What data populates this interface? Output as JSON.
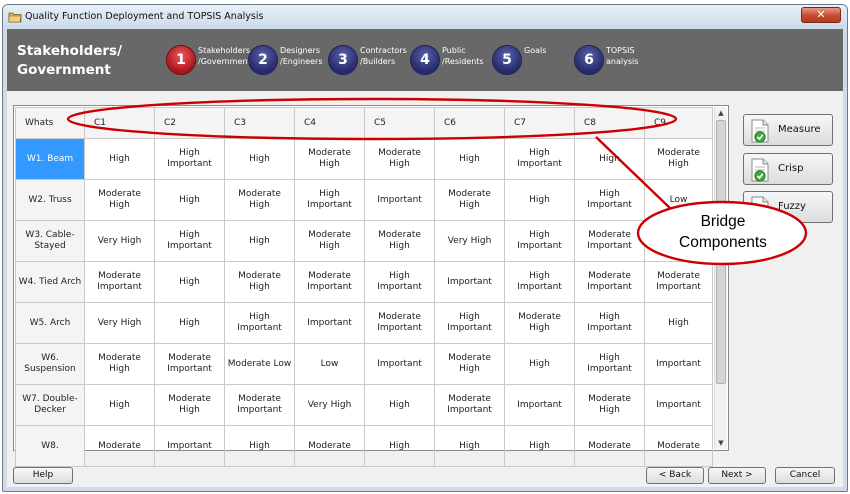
{
  "window": {
    "title": "Quality Function Deployment and TOPSIS Analysis",
    "close_glyph": "✕",
    "app_icon": "folder-icon"
  },
  "header": {
    "title": "Stakeholders/ Government",
    "steps": [
      {
        "number": "1",
        "label_line1": "Stakeholders",
        "label_line2": "/Government",
        "state": "active"
      },
      {
        "number": "2",
        "label_line1": "Designers",
        "label_line2": "/Engineers",
        "state": "inactive"
      },
      {
        "number": "3",
        "label_line1": "Contractors",
        "label_line2": "/Builders",
        "state": "inactive"
      },
      {
        "number": "4",
        "label_line1": "Public",
        "label_line2": "/Residents",
        "state": "inactive"
      },
      {
        "number": "5",
        "label_line1": "Goals",
        "label_line2": "",
        "state": "inactive"
      },
      {
        "number": "6",
        "label_line1": "TOPSIS",
        "label_line2": "analysis",
        "state": "inactive"
      }
    ],
    "colors": {
      "active": "#c4161c",
      "inactive": "#262c6e",
      "header_bg": "#686868"
    }
  },
  "grid": {
    "corner": "Whats",
    "columns": [
      "C1",
      "C2",
      "C3",
      "C4",
      "C5",
      "C6",
      "C7",
      "C8",
      "C9"
    ],
    "rows": [
      {
        "head": "W1. Beam",
        "selected": true,
        "cells": [
          "High",
          "High Important",
          "High",
          "Moderate High",
          "Moderate High",
          "High",
          "High Important",
          "High",
          "Moderate High"
        ]
      },
      {
        "head": "W2. Truss",
        "selected": false,
        "cells": [
          "Moderate High",
          "High",
          "Moderate High",
          "High Important",
          "Important",
          "Moderate High",
          "High",
          "High Important",
          "Low"
        ]
      },
      {
        "head": "W3. Cable-Stayed",
        "selected": false,
        "cells": [
          "Very High",
          "High Important",
          "High",
          "Moderate High",
          "Moderate High",
          "Very High",
          "High Important",
          "Moderate Important",
          ""
        ]
      },
      {
        "head": "W4. Tied Arch",
        "selected": false,
        "cells": [
          "Moderate Important",
          "High",
          "Moderate High",
          "Moderate Important",
          "High Important",
          "Important",
          "High Important",
          "Moderate Important",
          "Moderate Important"
        ]
      },
      {
        "head": "W5. Arch",
        "selected": false,
        "cells": [
          "Very High",
          "High",
          "High Important",
          "Important",
          "Moderate Important",
          "High Important",
          "Moderate High",
          "High Important",
          "High"
        ]
      },
      {
        "head": "W6. Suspension",
        "selected": false,
        "cells": [
          "Moderate High",
          "Moderate Important",
          "Moderate Low",
          "Low",
          "Important",
          "Moderate High",
          "High",
          "High Important",
          "Important"
        ]
      },
      {
        "head": "W7. Double-Decker",
        "selected": false,
        "cells": [
          "High",
          "Moderate High",
          "Moderate Important",
          "Very High",
          "High",
          "Moderate Important",
          "Important",
          "Moderate High",
          "Important"
        ]
      },
      {
        "head": "W8.",
        "selected": false,
        "cells": [
          "Moderate",
          "Important",
          "High",
          "Moderate",
          "High",
          "High",
          "High",
          "Moderate",
          "Moderate"
        ]
      }
    ],
    "selected_color": "#3399ff"
  },
  "side_buttons": [
    {
      "label": "Measure",
      "icon": "document-check-icon"
    },
    {
      "label": "Crisp",
      "icon": "document-check-icon"
    },
    {
      "label": "Fuzzy",
      "icon": "document-check-icon"
    }
  ],
  "footer": {
    "help": "Help",
    "back": "< Back",
    "next": "Next >",
    "cancel": "Cancel"
  },
  "annotation": {
    "line1": "Bridge",
    "line2": "Components",
    "color": "#cc0000"
  }
}
